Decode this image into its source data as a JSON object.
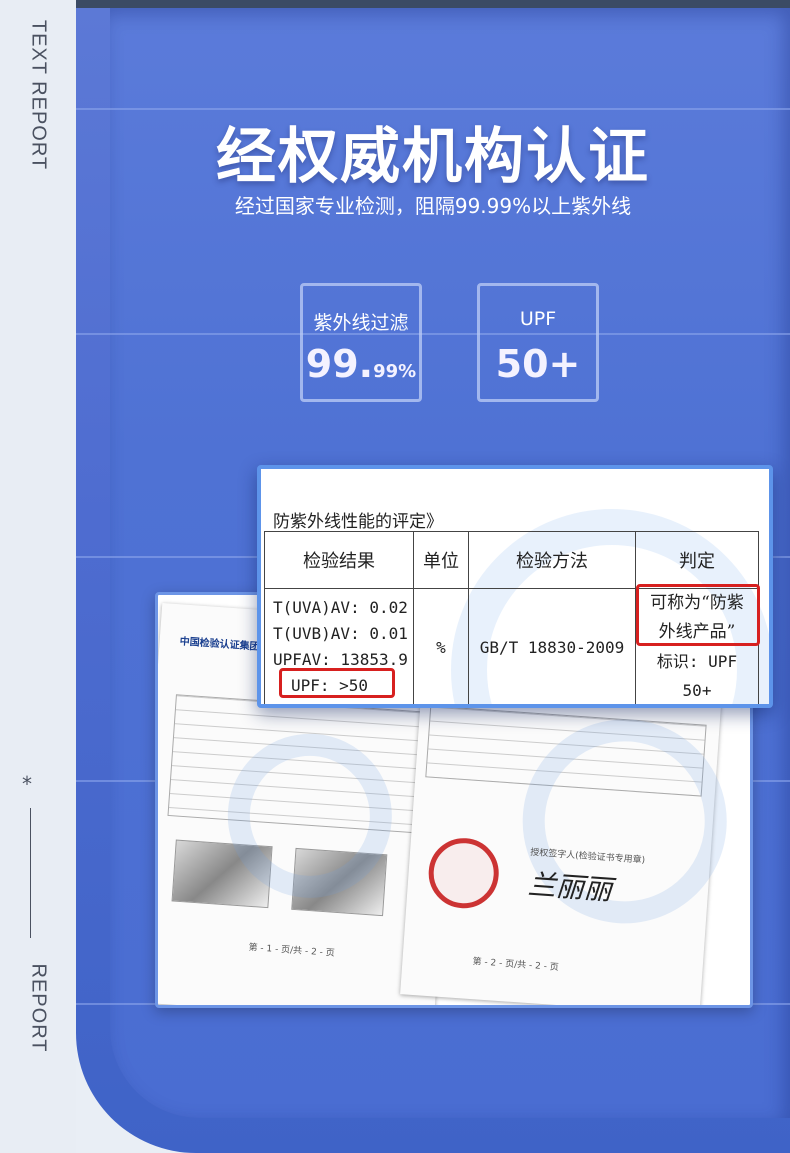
{
  "side": {
    "top_label": "TEXT REPORT",
    "bottom_label": "REPORT",
    "star": "*"
  },
  "header": {
    "title": "经权威机构认证",
    "subtitle": "经过国家专业检测，阻隔99.99%以上紫外线"
  },
  "stats": [
    {
      "label": "紫外线过滤",
      "value_main": "99.",
      "value_small": "99%"
    },
    {
      "label": "UPF",
      "value_main": "50+",
      "value_small": ""
    }
  ],
  "report": {
    "title": "防紫外线性能的评定》",
    "headers": [
      "检验结果",
      "单位",
      "检验方法",
      "判定"
    ],
    "results": [
      "T(UVA)AV: 0.02",
      "T(UVB)AV: 0.01",
      "UPFAV: 13853.9",
      "UPF: >50"
    ],
    "unit": "%",
    "method": "GB/T 18830-2009",
    "verdict_lines": [
      "可称为“防紫",
      "外线产品”"
    ],
    "mark_lines": [
      "标识: UPF",
      "50+"
    ]
  },
  "scan": {
    "left_sheet_header": "中国检验认证集团",
    "left_sheet_footer": "第 - 1 - 页/共 - 2 - 页",
    "right_sheet_footer": "第 - 2 - 页/共 - 2 - 页",
    "signer": "兰丽丽",
    "signer_caption": "授权签字人(检验证书专用章)"
  },
  "colors": {
    "panel": "#4f72d4",
    "accent_border": "#5d94ea",
    "highlight": "#d7201f"
  }
}
